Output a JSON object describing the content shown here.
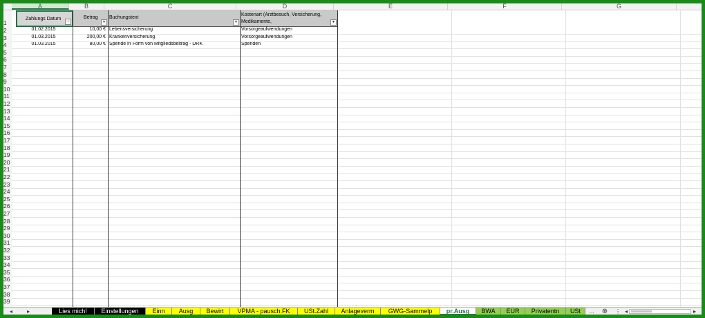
{
  "columns": [
    "A",
    "B",
    "C",
    "D",
    "E",
    "F",
    "G"
  ],
  "rows": [
    "1",
    "2",
    "3",
    "4",
    "5",
    "6",
    "7",
    "8",
    "9",
    "10",
    "11",
    "12",
    "13",
    "14",
    "15",
    "16",
    "17",
    "18",
    "19",
    "20",
    "21",
    "22",
    "23",
    "24",
    "25",
    "26",
    "27",
    "28",
    "29",
    "30",
    "31",
    "32",
    "33",
    "34",
    "35",
    "36",
    "37",
    "38",
    "39"
  ],
  "table": {
    "headers": {
      "date": "Zahlungs Datum",
      "amount": "Betrag",
      "text": "Buchungstext",
      "cost_type": "Kostenart (Arztbesuch, Versicherung, Medikamente,"
    },
    "records": [
      {
        "date": "01.02.2015",
        "amount": "10,00 €",
        "text": "Lebensversicherung",
        "cost_type": "Vorsorgeaufwendungen"
      },
      {
        "date": "01.03.2015",
        "amount": "200,00 €",
        "text": "Krankenversicherung",
        "cost_type": "Vorsorgeaufwendungen"
      },
      {
        "date": "01.03.2015",
        "amount": "80,00 €",
        "text": "Spende in Form von Mitgliedsbeitrag - DRK",
        "cost_type": "Spenden"
      }
    ]
  },
  "sheet_tabs": [
    {
      "label": "Lies mich!",
      "bg": "#000000",
      "fg": "#ffffff"
    },
    {
      "label": "Einstellungen",
      "bg": "#000000",
      "fg": "#ffffff"
    },
    {
      "label": "Einn",
      "bg": "#ffff00",
      "fg": "#000000"
    },
    {
      "label": "Ausg",
      "bg": "#ffff00",
      "fg": "#000000"
    },
    {
      "label": "Bewirt",
      "bg": "#ffff00",
      "fg": "#000000"
    },
    {
      "label": "VPMA - pausch.FK",
      "bg": "#ffff00",
      "fg": "#000000"
    },
    {
      "label": "USt.Zahl",
      "bg": "#ffff00",
      "fg": "#000000"
    },
    {
      "label": "Anlageverm",
      "bg": "#ffff00",
      "fg": "#000000"
    },
    {
      "label": "GWG-Sammelp",
      "bg": "#ffff00",
      "fg": "#000000"
    },
    {
      "label": "pr.Ausg",
      "bg": "#ffffff",
      "fg": "#217346"
    },
    {
      "label": "BWA",
      "bg": "#92d050",
      "fg": "#000000"
    },
    {
      "label": "EÜR",
      "bg": "#92d050",
      "fg": "#000000"
    },
    {
      "label": "Privatentn",
      "bg": "#92d050",
      "fg": "#000000"
    },
    {
      "label": "USt",
      "bg": "#92d050",
      "fg": "#000000"
    }
  ],
  "nav": {
    "prev": "◂",
    "next": "▸",
    "more": "...",
    "add": "⊕",
    "menu": "⋮",
    "scroll_left": "◂",
    "scroll_right": "▸"
  },
  "colors": {
    "frame": "#1a8a1a",
    "accent": "#217346"
  }
}
